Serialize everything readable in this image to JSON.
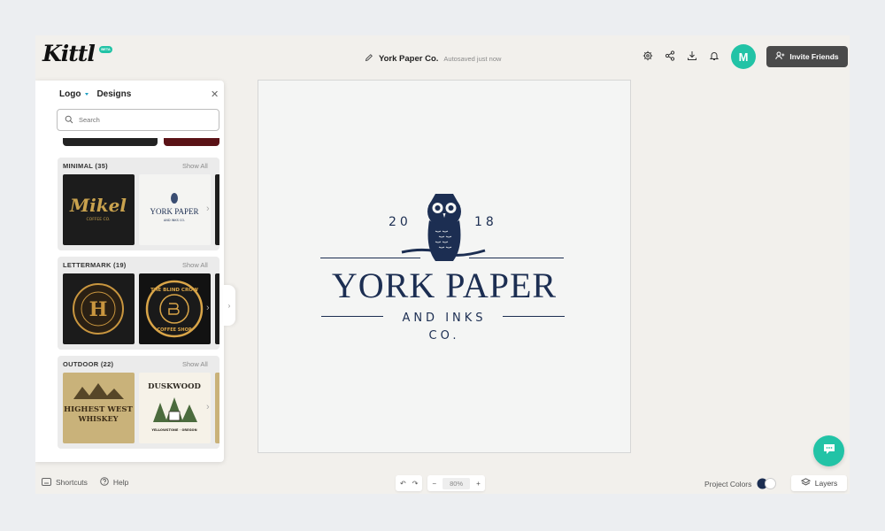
{
  "app": {
    "logo_text": "Kittl",
    "beta_label": "BETA"
  },
  "header": {
    "doc_title": "York Paper Co.",
    "doc_status": "Autosaved just now",
    "avatar_initial": "M",
    "invite_label": "Invite Friends",
    "icons": [
      "settings-icon",
      "share-icon",
      "download-icon",
      "bell-icon"
    ]
  },
  "rail": {
    "icons": [
      "edit-icon",
      "templates-icon",
      "text-icon",
      "shapes-icon",
      "upload-icon",
      "grid-icon"
    ]
  },
  "panel": {
    "category": "Logo",
    "tab": "Designs",
    "search_placeholder": "Search",
    "sections": [
      {
        "title": "MINIMAL (35)",
        "show_all": "Show All",
        "thumbs": [
          {
            "text": "Mikel",
            "subtext": "COFFEE CO.",
            "bg": "#1c1c1c",
            "fg": "#c9a24e"
          },
          {
            "text": "YORK PAPER",
            "subtext": "AND INKS CO.",
            "bg": "#f4f4f2",
            "fg": "#1c2e52"
          }
        ]
      },
      {
        "title": "LETTERMARK (19)",
        "show_all": "Show All",
        "thumbs": [
          {
            "text": "H",
            "subtext": "",
            "bg": "#1b1b1b",
            "fg": "#c9963f"
          },
          {
            "text": "THE BLIND CROW",
            "subtext": "COFFEE SHOP",
            "bg": "#121212",
            "fg": "#d9a548"
          }
        ]
      },
      {
        "title": "OUTDOOR (22)",
        "show_all": "Show All",
        "thumbs": [
          {
            "text": "HIGHEST WEST",
            "subtext": "WHISKEY",
            "bg": "#c9b27a",
            "fg": "#3a2a14"
          },
          {
            "text": "DUSKWOOD",
            "subtext": "YELLOWSTONE · OREGON",
            "bg": "#f6f2e8",
            "fg": "#2f2a22"
          }
        ]
      }
    ]
  },
  "canvas": {
    "year_left": "20",
    "year_right": "18",
    "name": "YORK PAPER",
    "line2": "AND INKS",
    "line3": "CO.",
    "ink_color": "#1c2e52"
  },
  "footer": {
    "shortcuts_label": "Shortcuts",
    "help_label": "Help",
    "zoom_value": "80%",
    "project_colors_label": "Project Colors",
    "layers_label": "Layers"
  },
  "colors": {
    "accent": "#22c3a6",
    "invite_bg": "#4a4a4a"
  }
}
